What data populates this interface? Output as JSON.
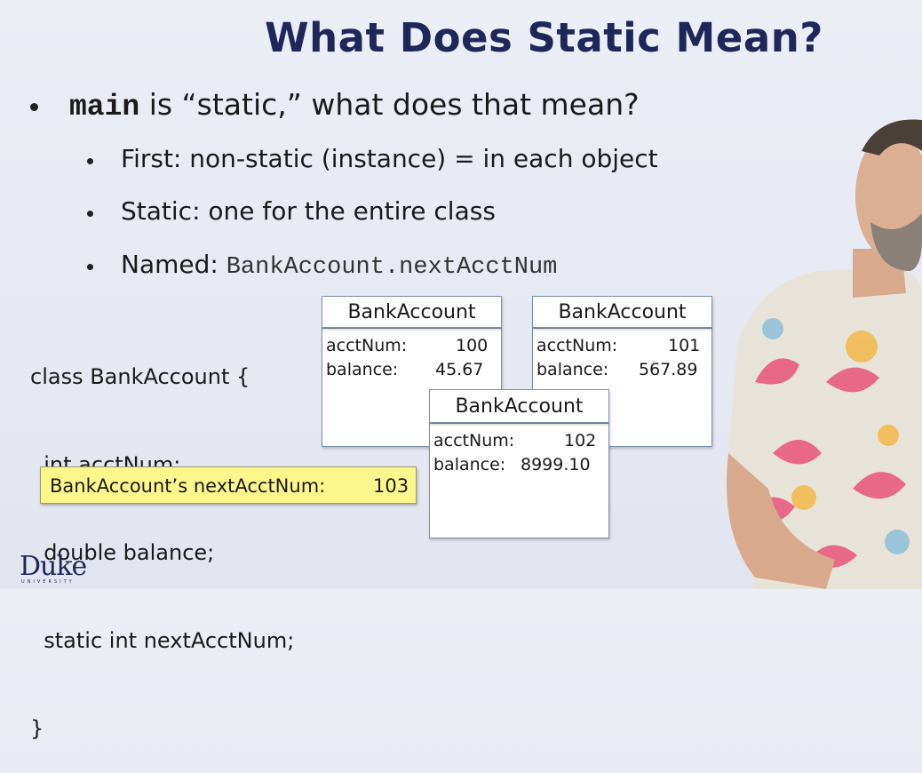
{
  "slide": {
    "title": "What Does Static Mean?",
    "bullet1": {
      "keyword": "main",
      "rest": " is “static,” what does that mean?"
    },
    "sub1": "First: non-static (instance) = in each object",
    "sub2": "Static: one for the entire class",
    "sub3_label": "Named: ",
    "sub3_code": "BankAccount.nextAcctNum"
  },
  "code": {
    "lines": [
      "class BankAccount {",
      "  int acctNum;",
      "  double balance;",
      "  static int nextAcctNum;",
      "}"
    ]
  },
  "highlight": {
    "label": "BankAccount’s nextAcctNum:",
    "value": "103"
  },
  "objects": [
    {
      "class": "BankAccount",
      "acct_label": "acctNum:",
      "acct_value": "100",
      "bal_label": "balance:",
      "bal_value": "45.67"
    },
    {
      "class": "BankAccount",
      "acct_label": "acctNum:",
      "acct_value": "101",
      "bal_label": "balance:",
      "bal_value": "567.89"
    },
    {
      "class": "BankAccount",
      "acct_label": "acctNum:",
      "acct_value": "102",
      "bal_label": "balance:",
      "bal_value": "8999.10"
    }
  ],
  "logo": {
    "name": "Duke",
    "sub": "UNIVERSITY"
  },
  "colors": {
    "title": "#1f2759",
    "highlight": "#fcf78a",
    "box_border": "#7a90b0"
  }
}
